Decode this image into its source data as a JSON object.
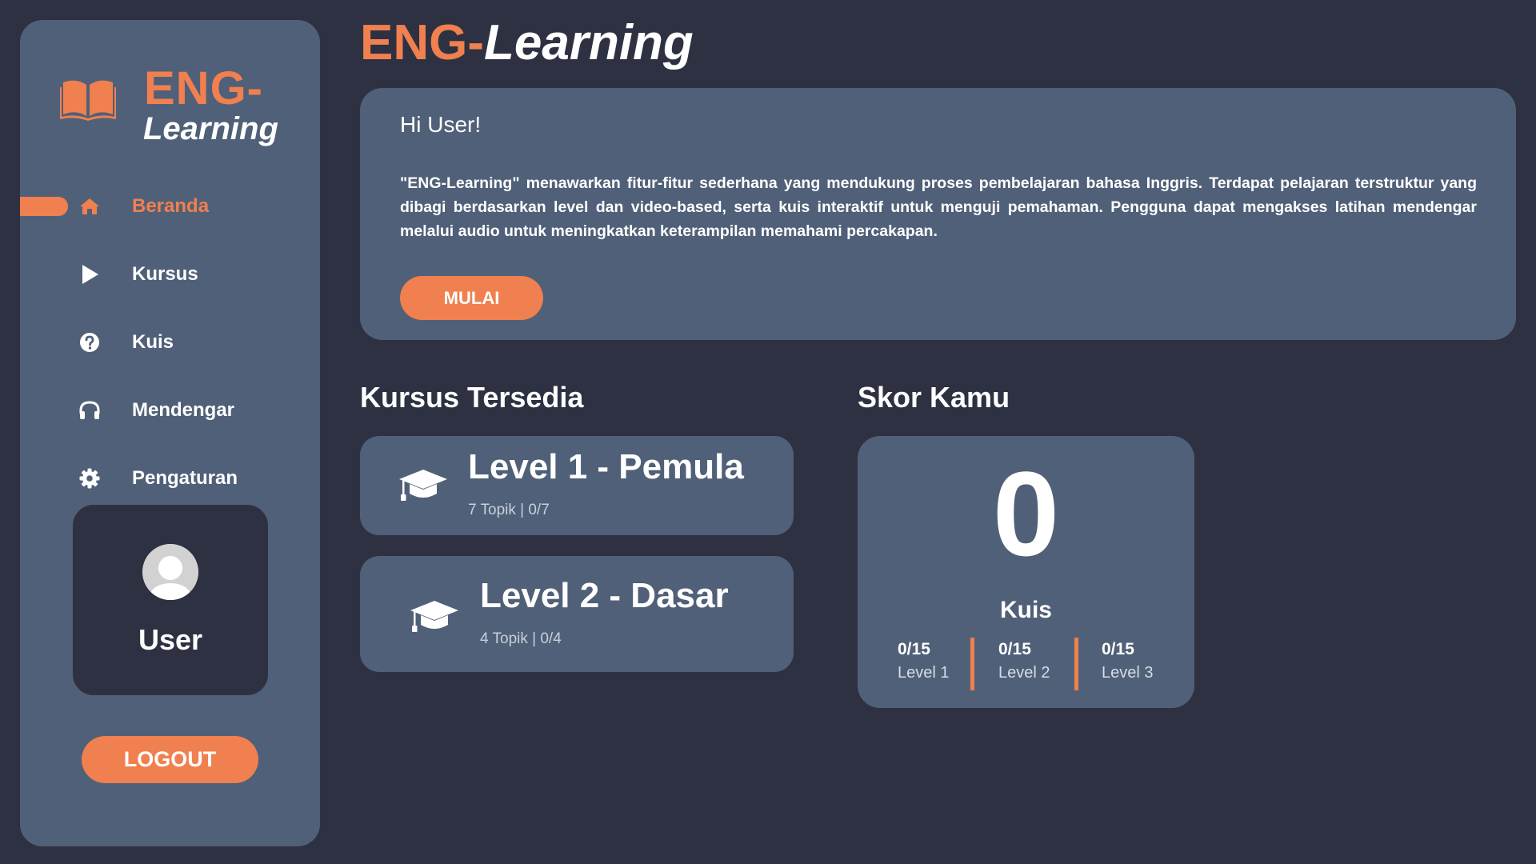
{
  "app": {
    "logo_part1": "ENG-",
    "logo_part2": "Learning",
    "title_part1": "ENG-",
    "title_part2": "Learning",
    "accent_color": "#f0804f",
    "panel_color": "#506078",
    "background_color": "#2e3142"
  },
  "sidebar": {
    "items": [
      {
        "label": "Beranda",
        "icon": "home-icon",
        "active": true
      },
      {
        "label": "Kursus",
        "icon": "play-icon",
        "active": false
      },
      {
        "label": "Kuis",
        "icon": "question-circle-icon",
        "active": false
      },
      {
        "label": "Mendengar",
        "icon": "headphones-icon",
        "active": false
      },
      {
        "label": "Pengaturan",
        "icon": "gear-icon",
        "active": false
      }
    ],
    "user_name": "User",
    "logout_label": "LOGOUT"
  },
  "welcome": {
    "greeting": "Hi User!",
    "description": "\"ENG-Learning\" menawarkan fitur-fitur sederhana yang mendukung proses pembelajaran bahasa Inggris. Terdapat pelajaran terstruktur yang dibagi berdasarkan level dan video-based, serta kuis interaktif untuk menguji pemahaman. Pengguna dapat mengakses latihan mendengar melalui audio untuk meningkatkan keterampilan memahami percakapan.",
    "start_label": "MULAI"
  },
  "courses": {
    "heading": "Kursus Tersedia",
    "items": [
      {
        "title": "Level 1 - Pemula",
        "meta": "7 Topik | 0/7"
      },
      {
        "title": "Level 2 - Dasar",
        "meta": "4 Topik | 0/4"
      }
    ]
  },
  "score": {
    "heading": "Skor Kamu",
    "value": "0",
    "label": "Kuis",
    "levels": [
      {
        "score": "0/15",
        "name": "Level 1"
      },
      {
        "score": "0/15",
        "name": "Level 2"
      },
      {
        "score": "0/15",
        "name": "Level 3"
      }
    ]
  }
}
